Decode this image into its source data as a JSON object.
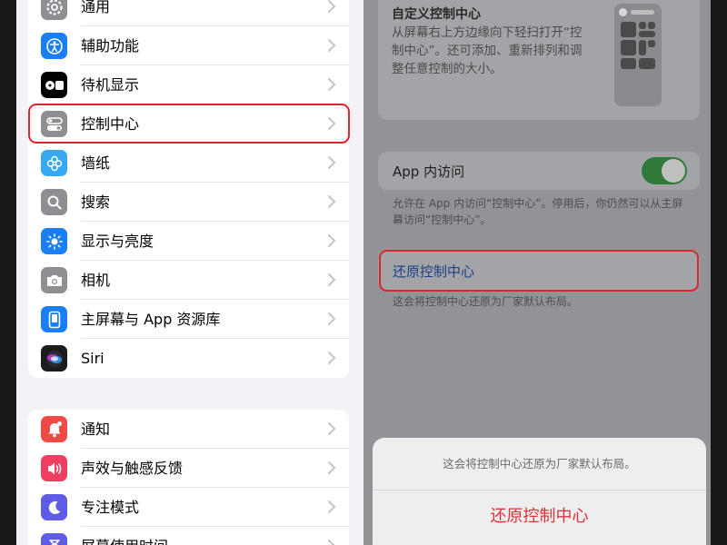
{
  "sidebar": {
    "group1": [
      {
        "label": "通用",
        "icon": "gear-icon",
        "color": "#8e8e93"
      },
      {
        "label": "辅助功能",
        "icon": "accessibility-icon",
        "color": "#1a7ef5"
      },
      {
        "label": "待机显示",
        "icon": "standby-icon",
        "color": "#000000"
      },
      {
        "label": "控制中心",
        "icon": "control-center-icon",
        "color": "#8e8e93"
      },
      {
        "label": "墙纸",
        "icon": "wallpaper-icon",
        "color": "#37a9f2"
      },
      {
        "label": "搜索",
        "icon": "search-icon",
        "color": "#8e8e93"
      },
      {
        "label": "显示与亮度",
        "icon": "brightness-icon",
        "color": "#1a7ef5"
      },
      {
        "label": "相机",
        "icon": "camera-icon",
        "color": "#8e8e93"
      },
      {
        "label": "主屏幕与 App 资源库",
        "icon": "home-screen-icon",
        "color": "#1a7ef5"
      },
      {
        "label": "Siri",
        "icon": "siri-icon",
        "color": "#1c1c1e"
      }
    ],
    "group2": [
      {
        "label": "通知",
        "icon": "notification-icon",
        "color": "#ef4a44"
      },
      {
        "label": "声效与触感反馈",
        "icon": "sound-icon",
        "color": "#ef3e5f"
      },
      {
        "label": "专注模式",
        "icon": "focus-moon-icon",
        "color": "#5e5ce6"
      },
      {
        "label": "屏幕使用时间",
        "icon": "screen-time-icon",
        "color": "#5e5ce6"
      }
    ]
  },
  "detail": {
    "customize": {
      "title": "自定义控制中心",
      "description": "从屏幕右上方边缘向下轻扫打开“控制中心”。还可添加、重新排列和调整任意控制的大小。"
    },
    "app_access": {
      "label": "App 内访问",
      "enabled": true,
      "footnote": "允许在 App 内访问“控制中心”。停用后，你仍然可以从主屏幕访问“控制中心”。"
    },
    "reset": {
      "label": "还原控制中心",
      "footnote": "这会将控制中心还原为厂家默认布局。"
    }
  },
  "action_sheet": {
    "message": "这会将控制中心还原为厂家默认布局。",
    "action_label": "还原控制中心"
  },
  "colors": {
    "highlight_ring": "#e0242b",
    "destructive": "#d9343a",
    "toggle_on": "#2f7a3b"
  }
}
